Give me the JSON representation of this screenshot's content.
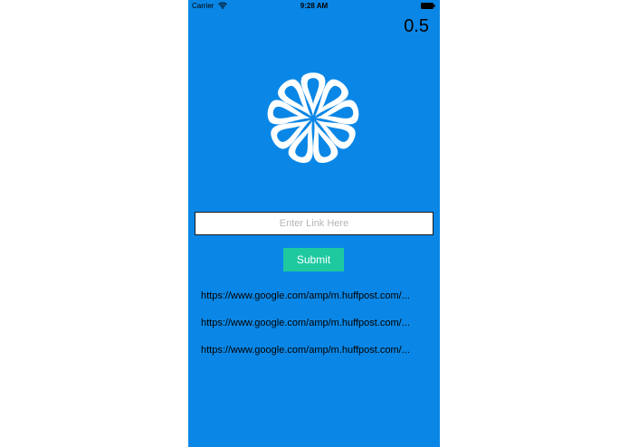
{
  "status_bar": {
    "carrier": "Carrier",
    "time": "9:28 AM"
  },
  "score": "0.5",
  "link_form": {
    "placeholder": "Enter Link Here",
    "value": "",
    "submit_label": "Submit"
  },
  "links": [
    "https://www.google.com/amp/m.huffpost.com/...",
    "https://www.google.com/amp/m.huffpost.com/...",
    "https://www.google.com/amp/m.huffpost.com/..."
  ],
  "colors": {
    "background": "#0a87e6",
    "button": "#1ec9a0",
    "logo": "#ffffff"
  },
  "icons": {
    "logo": "flower-logo-icon",
    "wifi": "wifi-icon",
    "battery": "battery-icon"
  }
}
